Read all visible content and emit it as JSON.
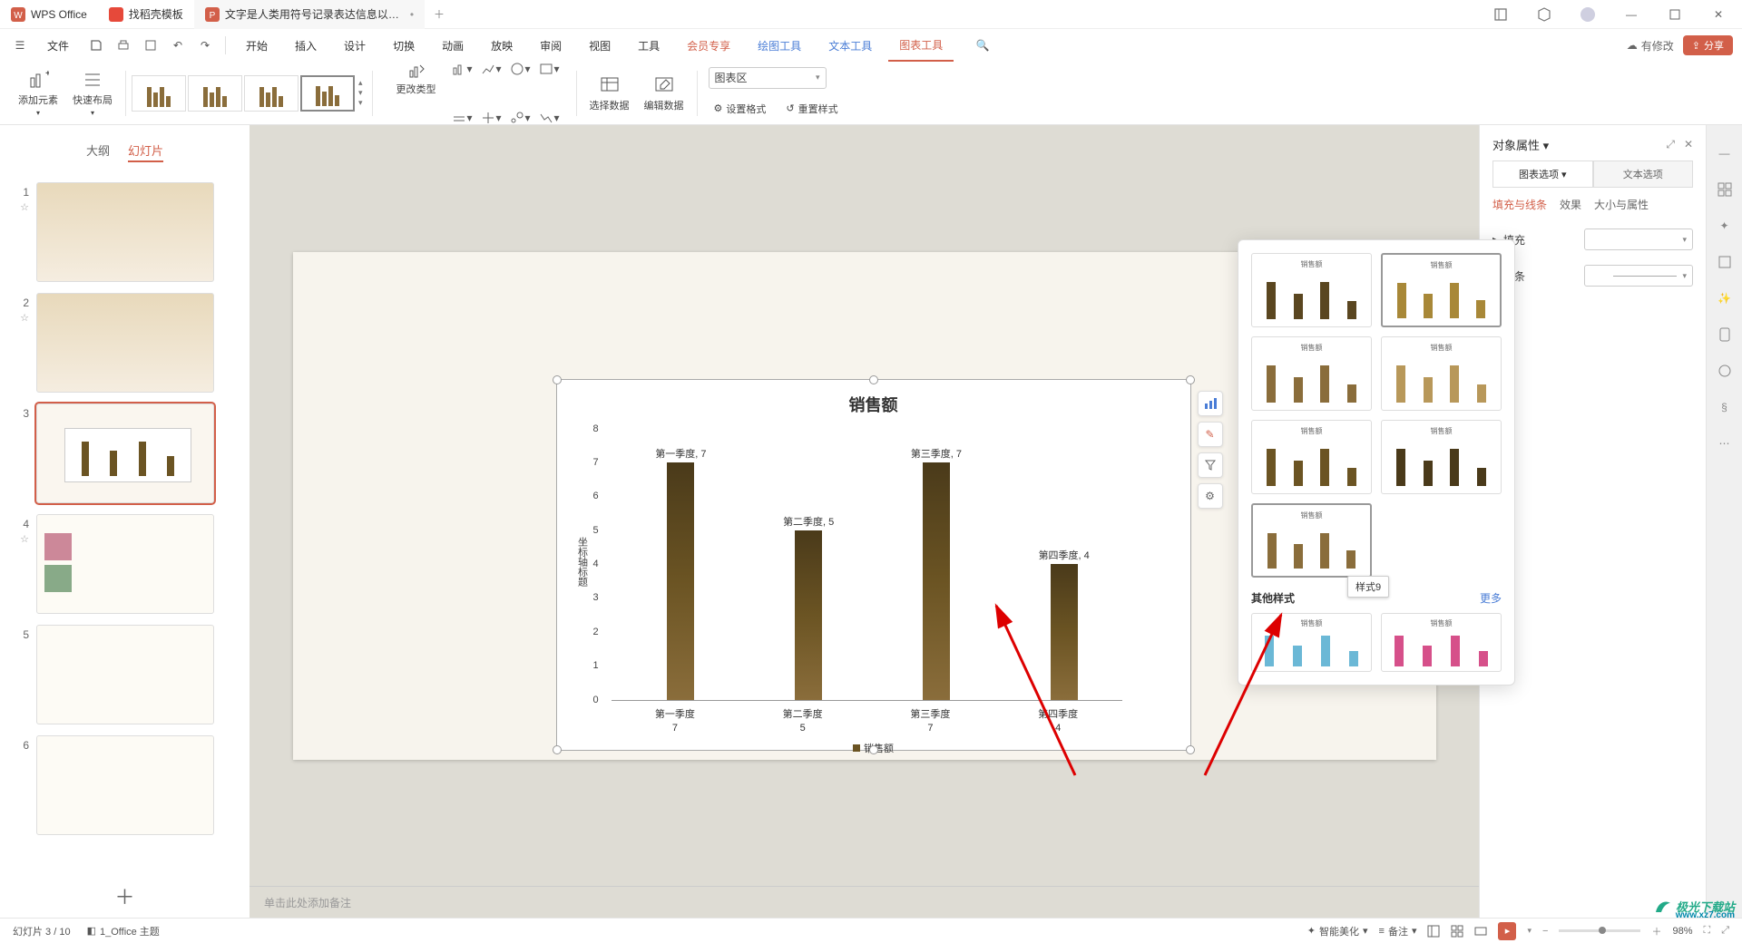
{
  "titlebar": {
    "tab1": "WPS Office",
    "tab2": "找稻壳模板",
    "tab3": "文字是人类用符号记录表达信息以…"
  },
  "menu": {
    "file": "文件",
    "tabs": [
      "开始",
      "插入",
      "设计",
      "切换",
      "动画",
      "放映",
      "审阅",
      "视图",
      "工具",
      "会员专享",
      "绘图工具",
      "文本工具",
      "图表工具"
    ],
    "save_status": "有修改",
    "share": "分享"
  },
  "toolbar": {
    "add_element": "添加元素",
    "quick_layout": "快速布局",
    "change_type": "更改类型",
    "select_data": "选择数据",
    "edit_data": "编辑数据",
    "set_style": "设置格式",
    "reset_style": "重置样式",
    "region": "图表区"
  },
  "left": {
    "outline": "大纲",
    "slides": "幻灯片",
    "nums": [
      "1",
      "2",
      "3",
      "4",
      "5",
      "6"
    ]
  },
  "chart_data": {
    "type": "bar",
    "title": "销售额",
    "ylabel": "坐标轴标题",
    "categories": [
      "第一季度",
      "第二季度",
      "第三季度",
      "第四季度"
    ],
    "values": [
      7,
      5,
      7,
      4
    ],
    "labels": [
      "第一季度, 7",
      "第二季度, 5",
      "第三季度, 7",
      "第四季度, 4"
    ],
    "ylim": [
      0,
      8
    ],
    "yticks": [
      0,
      1,
      2,
      3,
      4,
      5,
      6,
      7,
      8
    ],
    "legend": "销售额"
  },
  "popup": {
    "tooltip": "样式9",
    "other": "其他样式",
    "more": "更多"
  },
  "right_panel": {
    "title": "对象属性",
    "tab_chart": "图表选项",
    "tab_text": "文本选项",
    "sub_fill": "填充与线条",
    "sub_effect": "效果",
    "sub_size": "大小与属性",
    "fill": "填充",
    "line": "线条"
  },
  "notes_placeholder": "单击此处添加备注",
  "status": {
    "slide": "幻灯片 3 / 10",
    "theme": "1_Office 主题",
    "beautify": "智能美化",
    "notes": "备注",
    "zoom": "98%"
  },
  "watermark": {
    "main": "极光下载站",
    "sub": "www.xz7.com"
  }
}
